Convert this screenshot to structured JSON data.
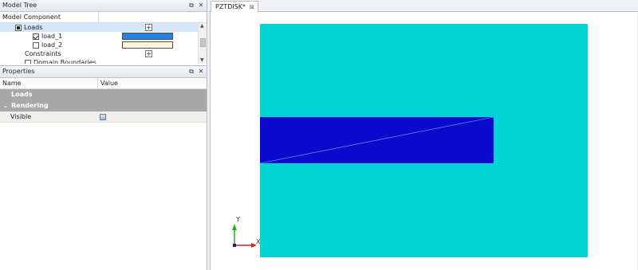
{
  "model_tree": {
    "title": "Model Tree",
    "float_icon": "⧉",
    "close_icon": "✕",
    "column_headers": [
      "Model Component",
      ""
    ],
    "rows": [
      {
        "label": "Loads",
        "indent": 30,
        "expander": "⌄",
        "checkbox": "mixed",
        "control": "plus"
      },
      {
        "label": "load_1",
        "indent": 52,
        "checkbox": "checked",
        "swatch": "#1e82e6"
      },
      {
        "label": "load_2",
        "indent": 52,
        "checkbox": "unchecked",
        "swatch": "#fdf6d8"
      },
      {
        "label": "Constraints",
        "indent": 31,
        "control": "plus"
      },
      {
        "label": "Domain Boundaries",
        "indent": 42,
        "checkbox": "unchecked"
      }
    ]
  },
  "properties": {
    "title": "Properties",
    "float_icon": "⧉",
    "close_icon": "✕",
    "column_headers": [
      "Name",
      "Value"
    ],
    "groups": [
      {
        "label": "Loads",
        "expander": ""
      },
      {
        "label": "Rendering",
        "expander": "⌄"
      }
    ],
    "rows": [
      {
        "name": "Visible",
        "value_icon": "checkbox-icon"
      }
    ]
  },
  "document_tab": {
    "label": "PZTDISK*",
    "close_icon": "⊠"
  },
  "viewport": {
    "background": "#00d4d4",
    "inclusion_color": "#0a0acf",
    "diagonal_color": "#7fb0ff",
    "axis_y_label": "Y",
    "axis_x_label": "X",
    "axis_y_color": "#1fb21f",
    "axis_x_color": "#e02020"
  },
  "colors": {
    "accent_blue": "#1e82e6",
    "selection": "#d4e6f7",
    "group_gray": "#a8a8a8"
  }
}
